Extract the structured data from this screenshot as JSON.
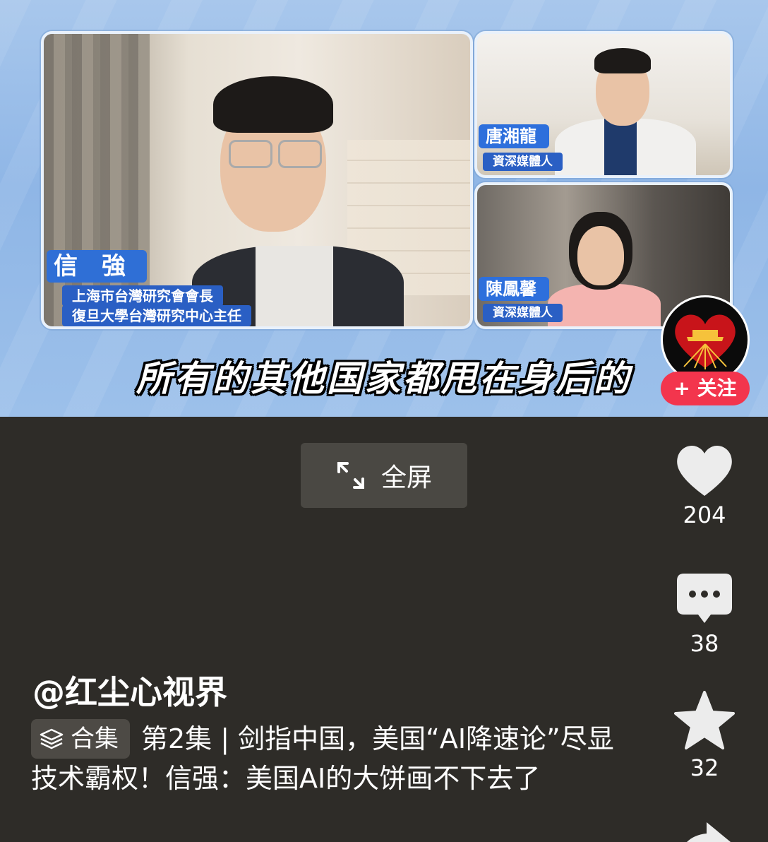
{
  "video": {
    "subtitle": "所有的其他国家都甩在身后的",
    "speakers": [
      {
        "name": "信　強",
        "titles": [
          "上海市台灣研究會會長",
          "復旦大學台灣研究中心主任"
        ]
      },
      {
        "name": "唐湘龍",
        "titles": [
          "資深媒體人"
        ]
      },
      {
        "name": "陳鳳馨",
        "titles": [
          "資深媒體人"
        ]
      }
    ],
    "follow_label": "+ 关注"
  },
  "player": {
    "fullscreen_label": "全屏"
  },
  "actions": {
    "likes": "204",
    "comments": "38",
    "favorites": "32"
  },
  "post": {
    "author": "@红尘心视界",
    "collection_label": "合集",
    "description": "第2集 | 剑指中国，美国“AI降速论”尽显技术霸权！信强：美国AI的大饼画不下去了"
  },
  "colors": {
    "background": "#2e2c28",
    "follow_button": "#f3354d",
    "name_tag": "#2f6fd6",
    "video_bg": "#9cc0ea"
  },
  "icons": [
    "expand-icon",
    "heart-icon",
    "comment-icon",
    "star-icon",
    "layers-icon",
    "share-icon"
  ]
}
